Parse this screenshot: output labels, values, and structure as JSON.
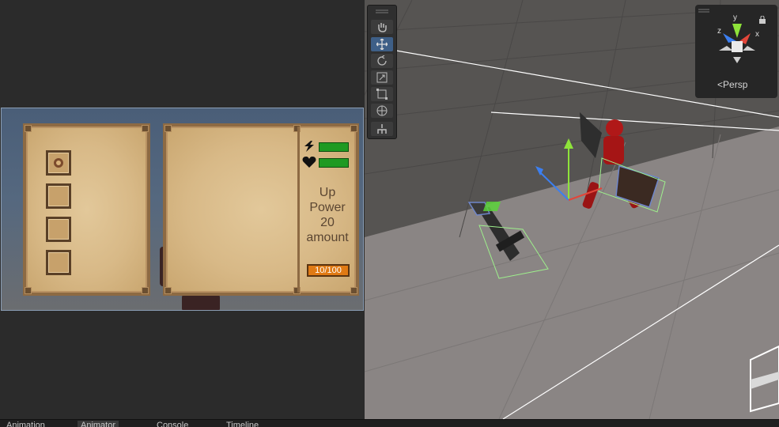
{
  "game_ui": {
    "stats": [
      {
        "icon": "lightning-icon",
        "bar_fill": 1.0
      },
      {
        "icon": "heart-icon",
        "bar_fill": 1.0
      }
    ],
    "description_lines": [
      "Up",
      "Power",
      "20",
      "amount"
    ],
    "counter": "10/100",
    "inventory_slots": [
      {
        "item": "ring-icon"
      },
      {
        "item": ""
      },
      {
        "item": ""
      },
      {
        "item": ""
      }
    ]
  },
  "scene": {
    "gizmo": {
      "axes": [
        "y",
        "z",
        "x"
      ],
      "projection_label": "Persp"
    },
    "tools": [
      "hand-tool",
      "move-tool",
      "rotate-tool",
      "scale-tool",
      "rect-tool",
      "transform-tool",
      "custom-tool"
    ],
    "active_tool": "move-tool",
    "colors": {
      "x_axis": "#e2463a",
      "y_axis": "#8ee33a",
      "z_axis": "#3c7ff0",
      "selection": "#9ef08c"
    }
  },
  "bottom_tabs": [
    {
      "label": "Animation"
    },
    {
      "label": "Animator"
    },
    {
      "label": "Console"
    },
    {
      "label": "Timeline"
    }
  ]
}
